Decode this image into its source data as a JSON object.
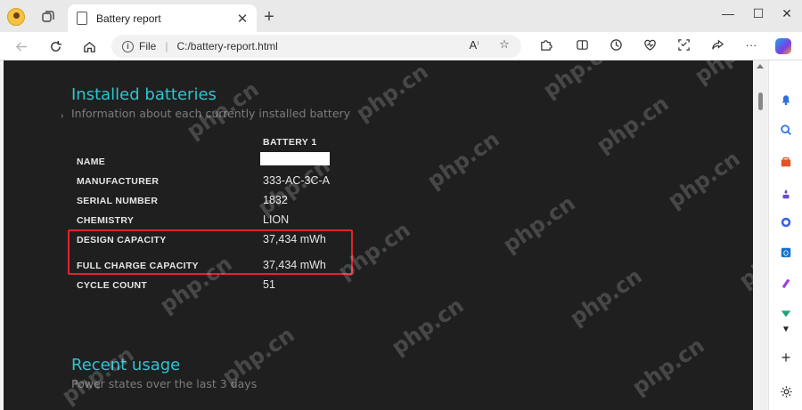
{
  "browser": {
    "tab_title": "Battery report",
    "tab_close_glyph": "✕",
    "new_tab_glyph": "+",
    "address_scheme": "File",
    "address_url": "C:/battery-report.html",
    "window_controls": [
      "—",
      "☐",
      "✕"
    ],
    "accent": "#2ec4d1"
  },
  "report": {
    "installed": {
      "title": "Installed batteries",
      "subtitle": "Information about each currently installed battery",
      "column_header": "BATTERY 1",
      "rows": [
        {
          "label": "NAME",
          "value": ""
        },
        {
          "label": "MANUFACTURER",
          "value": "333-AC-3C-A"
        },
        {
          "label": "SERIAL NUMBER",
          "value": "1832"
        },
        {
          "label": "CHEMISTRY",
          "value": "LION"
        },
        {
          "label": "DESIGN CAPACITY",
          "value": "37,434 mWh"
        },
        {
          "label": "FULL CHARGE CAPACITY",
          "value": "37,434 mWh"
        },
        {
          "label": "CYCLE COUNT",
          "value": "51"
        }
      ]
    },
    "recent": {
      "title": "Recent usage",
      "subtitle": "Power states over the last 3 days"
    }
  },
  "watermark": "php.cn",
  "highlight_color": "#e0242d",
  "icons": {
    "profile": "profile-avatar-icon",
    "tabs": "workspaces-icon",
    "back": "back-arrow-icon",
    "refresh": "refresh-icon",
    "home": "home-icon",
    "read_aloud": "read-aloud-icon",
    "favorite": "star-icon",
    "extensions": "puzzle-icon",
    "split": "split-screen-icon",
    "history": "history-icon",
    "health": "browser-essentials-icon",
    "capture": "screenshot-icon",
    "share": "share-icon",
    "more": "more-icon",
    "copilot": "copilot-icon"
  }
}
